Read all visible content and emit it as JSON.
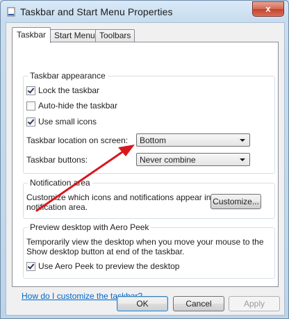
{
  "window": {
    "title": "Taskbar and Start Menu Properties",
    "close_label": "x"
  },
  "tabs": [
    {
      "label": "Taskbar",
      "active": true
    },
    {
      "label": "Start Menu",
      "active": false
    },
    {
      "label": "Toolbars",
      "active": false
    }
  ],
  "appearance": {
    "title": "Taskbar appearance",
    "lock": {
      "label": "Lock the taskbar",
      "checked": true
    },
    "autohide": {
      "label": "Auto-hide the taskbar",
      "checked": false
    },
    "small_icons": {
      "label": "Use small icons",
      "checked": true
    },
    "location_label": "Taskbar location on screen:",
    "location_value": "Bottom",
    "buttons_label": "Taskbar buttons:",
    "buttons_value": "Never combine"
  },
  "notification": {
    "title": "Notification area",
    "description_line1": "Customize which icons and notifications appear in the",
    "description_line2": "notification area.",
    "customize_label": "Customize..."
  },
  "peek": {
    "title": "Preview desktop with Aero Peek",
    "description_line1": "Temporarily view the desktop when you move your mouse to the",
    "description_line2": "Show desktop button at end of the taskbar.",
    "checkbox": {
      "label": "Use Aero Peek to preview the desktop",
      "checked": true
    }
  },
  "help_link": "How do I customize the taskbar?",
  "footer": {
    "ok_label": "OK",
    "cancel_label": "Cancel",
    "apply_label": "Apply"
  },
  "colors": {
    "annotation_arrow": "#d6191f",
    "link": "#0066cc",
    "close_button": "#c3442e"
  }
}
